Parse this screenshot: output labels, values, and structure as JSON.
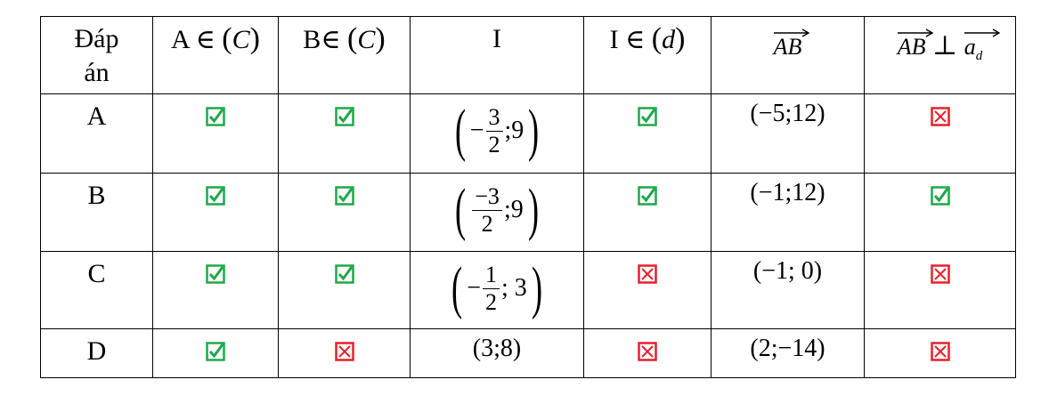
{
  "headers": {
    "dap_an": [
      "Đáp",
      "án"
    ],
    "a_in_c": {
      "letter": "A",
      "symbol": "∈",
      "set": "C"
    },
    "b_in_c": {
      "letter": "B",
      "symbol": "∈",
      "set": "C"
    },
    "i": "I",
    "i_in_d": {
      "letter": "I",
      "symbol": "∈",
      "set": "d"
    },
    "ab": "AB",
    "ab_perp_ad": {
      "vec": "AB",
      "perp": "⊥",
      "a": "a",
      "sub": "d"
    }
  },
  "rows": [
    {
      "label": "A",
      "a_in_c": "check",
      "b_in_c": "check",
      "i": {
        "sign": "−",
        "num": "3",
        "den": "2",
        "rest": ";9"
      },
      "i_in_d": "check",
      "ab": "(−5;12)",
      "perp": "cross"
    },
    {
      "label": "B",
      "a_in_c": "check",
      "b_in_c": "check",
      "i": {
        "sign": "",
        "num": "−3",
        "den": "2",
        "rest": ";9"
      },
      "i_in_d": "check",
      "ab": "(−1;12)",
      "perp": "check"
    },
    {
      "label": "C",
      "a_in_c": "check",
      "b_in_c": "check",
      "i": {
        "sign": "−",
        "num": "1",
        "den": "2",
        "rest": "; 3"
      },
      "i_in_d": "cross",
      "ab": "(−1; 0)",
      "perp": "cross"
    },
    {
      "label": "D",
      "a_in_c": "check",
      "b_in_c": "cross",
      "i": {
        "plain": "(3;8)"
      },
      "i_in_d": "cross",
      "ab": "(2;−14)",
      "perp": "cross"
    }
  ],
  "colors": {
    "check": "#1fa84a",
    "cross": "#e8202a",
    "border": "#000000"
  }
}
